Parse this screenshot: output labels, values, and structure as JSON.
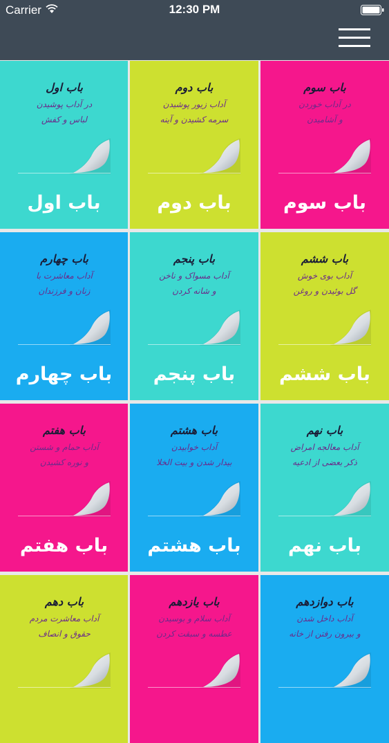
{
  "status_bar": {
    "carrier": "Carrier",
    "time": "12:30 PM"
  },
  "header": {
    "menu_icon": "hamburger-menu-icon"
  },
  "colors": {
    "header": "#3e4a56",
    "cyan": "#3dd8cf",
    "lime": "#cde030",
    "magenta": "#f5178c",
    "blue": "#1aacf0"
  },
  "chapters": [
    {
      "label": "باب اول",
      "color": "#3dd8cf",
      "heading": "باب اول",
      "lines": [
        "در آداب پوشیدن",
        "لباس و کفش"
      ]
    },
    {
      "label": "باب دوم",
      "color": "#cde030",
      "heading": "باب دوم",
      "lines": [
        "آداب زیور پوشیدن",
        "سرمه کشیدن و آینه"
      ]
    },
    {
      "label": "باب سوم",
      "color": "#f5178c",
      "heading": "باب سوم",
      "lines": [
        "در آداب خوردن",
        "و آشامیدن"
      ]
    },
    {
      "label": "باب چهارم",
      "color": "#1aacf0",
      "heading": "باب چهارم",
      "lines": [
        "آداب معاشرت با",
        "زنان و فرزندان"
      ]
    },
    {
      "label": "باب پنجم",
      "color": "#3dd8cf",
      "heading": "باب پنجم",
      "lines": [
        "آداب مسواک و ناخن",
        "و شانه کردن"
      ]
    },
    {
      "label": "باب ششم",
      "color": "#cde030",
      "heading": "باب ششم",
      "lines": [
        "آداب بوی خوش",
        "گل بوئیدن و روغن"
      ]
    },
    {
      "label": "باب هفتم",
      "color": "#f5178c",
      "heading": "باب هفتم",
      "lines": [
        "آداب حمام و شستن",
        "و نوره کشیدن"
      ]
    },
    {
      "label": "باب هشتم",
      "color": "#1aacf0",
      "heading": "باب هشتم",
      "lines": [
        "آداب خوابیدن",
        "بیدار شدن و بیت الخلا"
      ]
    },
    {
      "label": "باب نهم",
      "color": "#3dd8cf",
      "heading": "باب نهم",
      "lines": [
        "آداب معالجه امراض",
        "ذکر بعضی از ادعیه"
      ]
    },
    {
      "label": "",
      "color": "#cde030",
      "heading": "باب دهم",
      "lines": [
        "آداب معاشرت مردم",
        "حقوق و انصاف"
      ]
    },
    {
      "label": "",
      "color": "#f5178c",
      "heading": "باب یازدهم",
      "lines": [
        "آداب سلام و بوسیدن",
        "عطسه و سبقت کردن"
      ]
    },
    {
      "label": "",
      "color": "#1aacf0",
      "heading": "باب دوازدهم",
      "lines": [
        "آداب داخل شدن",
        "و بیرون رفتن از خانه"
      ]
    }
  ]
}
